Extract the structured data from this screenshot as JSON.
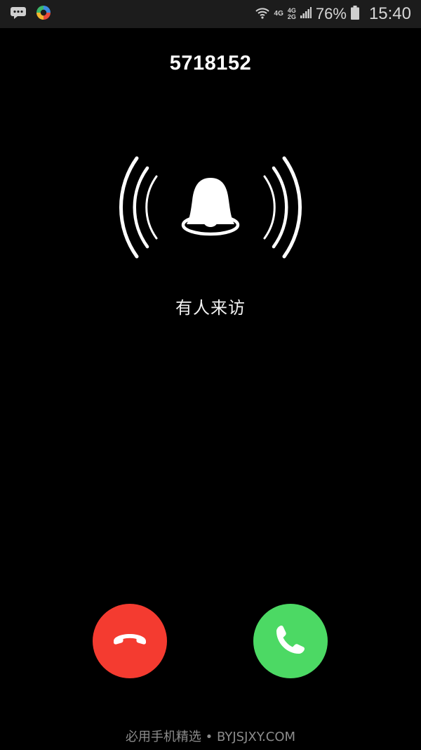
{
  "status_bar": {
    "net_primary": "4G",
    "net_secondary_top": "4G",
    "net_secondary_bottom": "2G",
    "battery_percent": "76%",
    "time": "15:40",
    "icons": [
      "chat-bubble-icon",
      "app-logo-icon",
      "wifi-icon",
      "signal-icon",
      "battery-icon"
    ]
  },
  "call": {
    "number": "5718152",
    "label": "有人来访",
    "icon": "bell-ringing-icon"
  },
  "buttons": {
    "decline_icon": "phone-hangup-icon",
    "accept_icon": "phone-icon"
  },
  "watermark": "必用手机精选 • BYJSJXY.COM",
  "colors": {
    "background": "#000000",
    "decline": "#f43b30",
    "accept": "#4cd964"
  }
}
